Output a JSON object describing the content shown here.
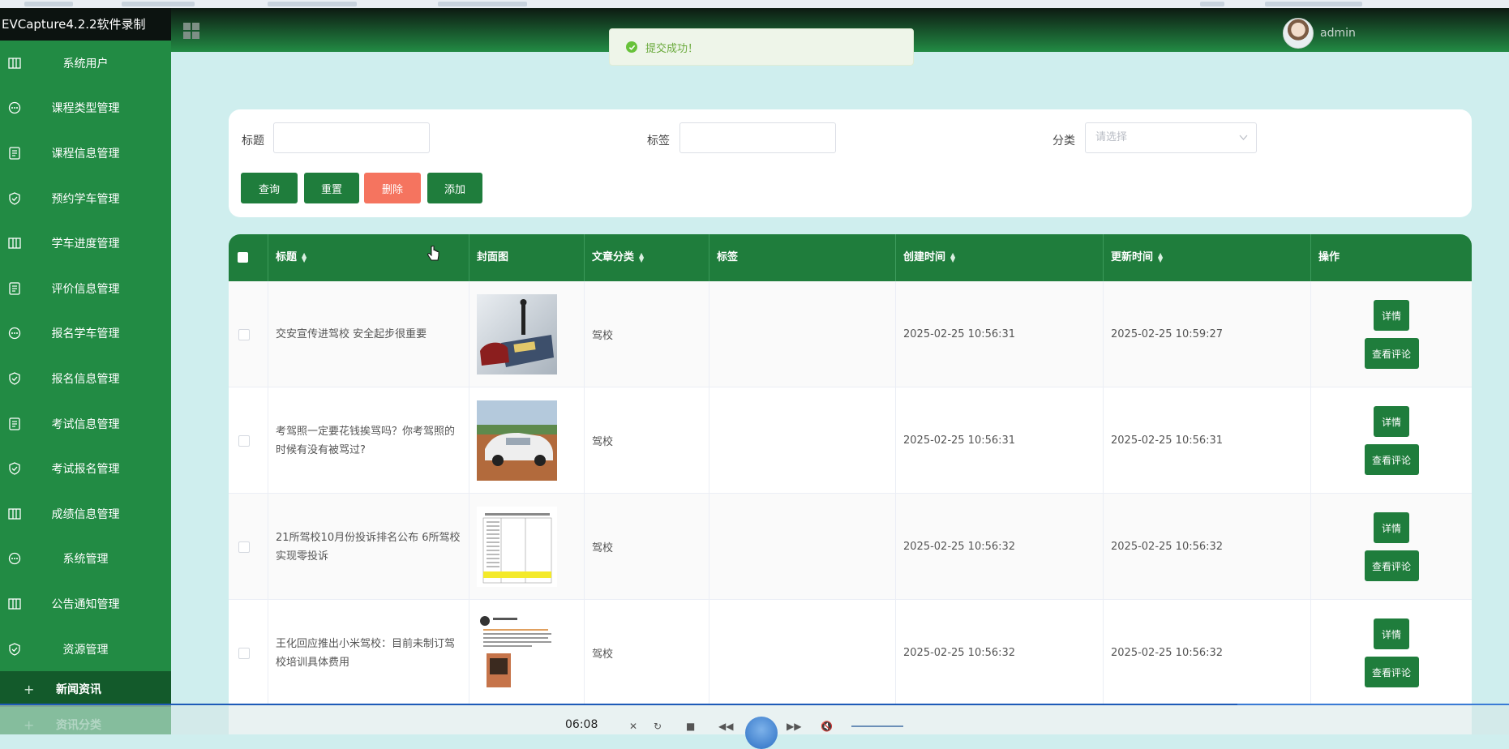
{
  "app": {
    "title": "EVCapture4.2.2软件录制"
  },
  "sidebar": {
    "items": [
      {
        "label": "系统用户",
        "icon": "columns-icon"
      },
      {
        "label": "课程类型管理",
        "icon": "chat-icon"
      },
      {
        "label": "课程信息管理",
        "icon": "document-icon"
      },
      {
        "label": "预约学车管理",
        "icon": "shield-check-icon"
      },
      {
        "label": "学车进度管理",
        "icon": "columns-icon"
      },
      {
        "label": "评价信息管理",
        "icon": "document-icon"
      },
      {
        "label": "报名学车管理",
        "icon": "chat-icon"
      },
      {
        "label": "报名信息管理",
        "icon": "shield-check-icon"
      },
      {
        "label": "考试信息管理",
        "icon": "document-icon"
      },
      {
        "label": "考试报名管理",
        "icon": "shield-check-icon"
      },
      {
        "label": "成绩信息管理",
        "icon": "columns-icon"
      },
      {
        "label": "系统管理",
        "icon": "chat-icon"
      },
      {
        "label": "公告通知管理",
        "icon": "columns-icon"
      },
      {
        "label": "资源管理",
        "icon": "shield-check-icon"
      }
    ],
    "sub_items": [
      {
        "label": "新闻资讯",
        "active": true
      },
      {
        "label": "资讯分类",
        "active": false
      }
    ]
  },
  "topbar": {
    "user": "admin"
  },
  "toast": {
    "message": "提交成功！"
  },
  "search": {
    "title_label": "标题",
    "tag_label": "标签",
    "category_label": "分类",
    "category_placeholder": "请选择",
    "buttons": {
      "query": "查询",
      "reset": "重置",
      "delete": "删除",
      "add": "添加"
    }
  },
  "table": {
    "headers": {
      "title": "标题",
      "cover": "封面图",
      "category": "文章分类",
      "tags": "标签",
      "created": "创建时间",
      "updated": "更新时间",
      "actions": "操作"
    },
    "detail_label": "详情",
    "comment_label": "查看评论",
    "rows": [
      {
        "title": "交安宣传进驾校 安全起步很重要",
        "category": "驾校",
        "tags": "",
        "created": "2025-02-25 10:56:31",
        "updated": "2025-02-25 10:59:27"
      },
      {
        "title": "考驾照一定要花钱挨骂吗？你考驾照的时候有没有被骂过?",
        "category": "驾校",
        "tags": "",
        "created": "2025-02-25 10:56:31",
        "updated": "2025-02-25 10:56:31"
      },
      {
        "title": "21所驾校10月份投诉排名公布 6所驾校实现零投诉",
        "category": "驾校",
        "tags": "",
        "created": "2025-02-25 10:56:32",
        "updated": "2025-02-25 10:56:32"
      },
      {
        "title": "王化回应推出小米驾校：目前未制订驾校培训具体费用",
        "category": "驾校",
        "tags": "",
        "created": "2025-02-25 10:56:32",
        "updated": "2025-02-25 10:56:32"
      }
    ]
  },
  "player": {
    "time": "06:08",
    "progress": 0.82
  },
  "colors": {
    "sidebar": "#228b44",
    "primary": "#1f7d3c",
    "danger": "#f5745f",
    "page_bg": "#cfeeee",
    "toast": "#67c23a"
  }
}
